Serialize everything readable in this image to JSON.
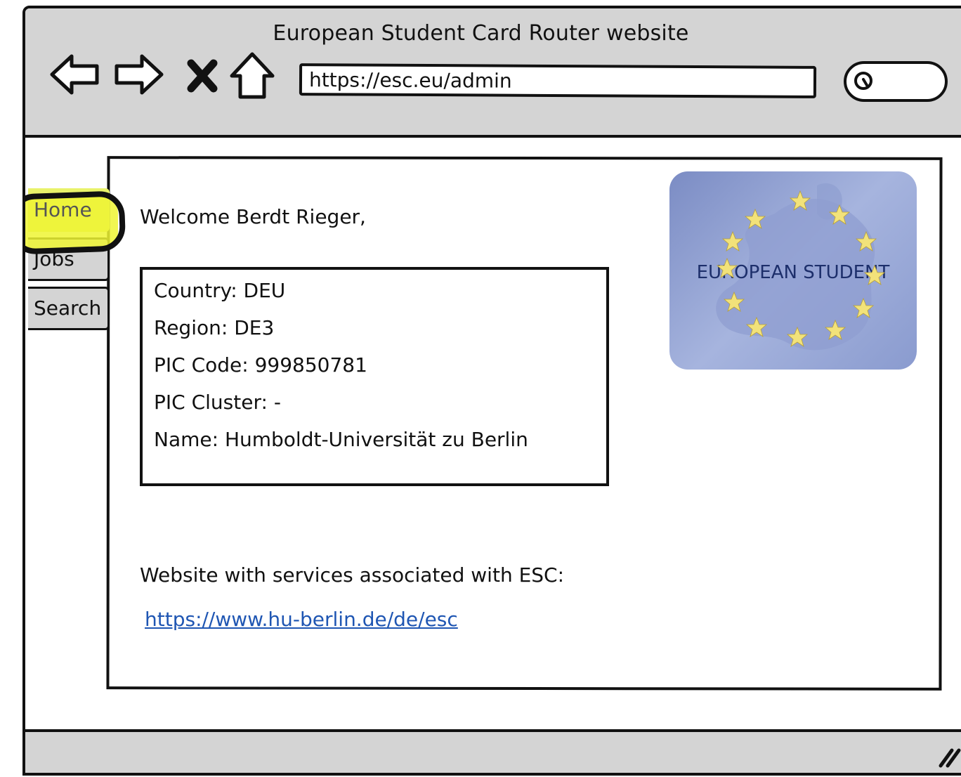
{
  "window": {
    "title": "European Student Card Router website"
  },
  "toolbar": {
    "back_icon": "back-arrow-icon",
    "forward_icon": "forward-arrow-icon",
    "stop_icon": "close-icon",
    "home_icon": "home-icon",
    "search_icon": "search-icon"
  },
  "address_bar": {
    "value": "https://esc.eu/admin"
  },
  "sidebar": {
    "tabs": [
      {
        "label": "Home",
        "active": true
      },
      {
        "label": "Jobs",
        "active": false
      },
      {
        "label": "Search",
        "active": false
      }
    ],
    "highlight_color": "#eef532"
  },
  "main": {
    "welcome": "Welcome Berdt Rieger,",
    "info": {
      "country": "Country: DEU",
      "region": "Region: DE3",
      "pic_code": "PIC Code: 999850781",
      "pic_cluster": "PIC Cluster: -",
      "name": "Name: Humboldt-Universität zu Berlin"
    },
    "logo": {
      "text": "EUROPEAN STUDENT"
    },
    "services_label": "Website with services associated with ESC:",
    "services_link": "https://www.hu-berlin.de/de/esc"
  },
  "colors": {
    "chrome": "#d4d4d4",
    "link": "#1f56b3",
    "logo_star": "#f2e27a"
  }
}
